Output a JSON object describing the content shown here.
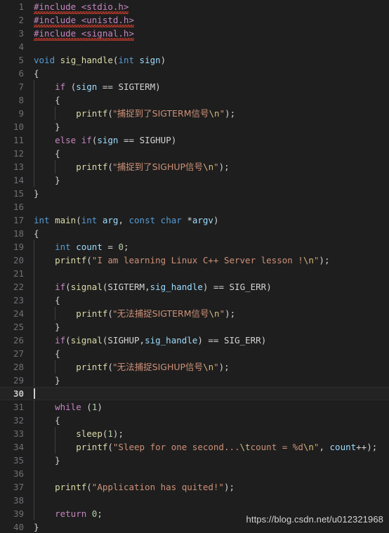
{
  "editor": {
    "theme_name": "dark-plus",
    "background": "#1e1e1e",
    "active_line_background": "#232323",
    "gutter_color": "#6e7074",
    "language": "c",
    "total_lines": 40,
    "active_line": 30,
    "colors": {
      "preprocessor": "#c586c0",
      "keyword": "#c586c0",
      "type": "#569cd6",
      "function": "#dcdcaa",
      "string": "#ce9178",
      "escape": "#d7ba7d",
      "number": "#b5cea8",
      "variable": "#9cdcfe",
      "plain": "#d4d4d4",
      "error_squiggle": "#c0392b",
      "indent_guide": "#3f4042"
    }
  },
  "watermark": {
    "text": "https://blog.csdn.net/u012321968"
  },
  "lines": [
    {
      "n": "1",
      "indent": 0,
      "error": true,
      "tokens": [
        {
          "c": "t-pre",
          "t": "#include <stdio.h>"
        }
      ]
    },
    {
      "n": "2",
      "indent": 0,
      "error": true,
      "tokens": [
        {
          "c": "t-pre",
          "t": "#include <unistd.h>"
        }
      ]
    },
    {
      "n": "3",
      "indent": 0,
      "error": true,
      "tokens": [
        {
          "c": "t-pre",
          "t": "#include <signal.h>"
        }
      ]
    },
    {
      "n": "4",
      "indent": 0,
      "tokens": []
    },
    {
      "n": "5",
      "indent": 0,
      "tokens": [
        {
          "c": "t-type",
          "t": "void"
        },
        {
          "c": "t-plain",
          "t": " "
        },
        {
          "c": "t-fn",
          "t": "sig_handle"
        },
        {
          "c": "t-punct",
          "t": "("
        },
        {
          "c": "t-type",
          "t": "int"
        },
        {
          "c": "t-plain",
          "t": " "
        },
        {
          "c": "t-var",
          "t": "sign"
        },
        {
          "c": "t-punct",
          "t": ")"
        }
      ]
    },
    {
      "n": "6",
      "indent": 0,
      "tokens": [
        {
          "c": "t-brace",
          "t": "{"
        }
      ]
    },
    {
      "n": "7",
      "indent": 1,
      "tokens": [
        {
          "c": "t-plain",
          "t": "    "
        },
        {
          "c": "t-kw",
          "t": "if"
        },
        {
          "c": "t-plain",
          "t": " "
        },
        {
          "c": "t-punct",
          "t": "("
        },
        {
          "c": "t-var",
          "t": "sign"
        },
        {
          "c": "t-plain",
          "t": " "
        },
        {
          "c": "t-op",
          "t": "=="
        },
        {
          "c": "t-plain",
          "t": " "
        },
        {
          "c": "t-const",
          "t": "SIGTERM"
        },
        {
          "c": "t-punct",
          "t": ")"
        }
      ]
    },
    {
      "n": "8",
      "indent": 1,
      "tokens": [
        {
          "c": "t-plain",
          "t": "    "
        },
        {
          "c": "t-brace",
          "t": "{"
        }
      ]
    },
    {
      "n": "9",
      "indent": 2,
      "tokens": [
        {
          "c": "t-plain",
          "t": "        "
        },
        {
          "c": "t-fn",
          "t": "printf"
        },
        {
          "c": "t-punct",
          "t": "("
        },
        {
          "c": "t-str",
          "t": "\"捕捉到了SIGTERM信号"
        },
        {
          "c": "t-esc",
          "t": "\\n"
        },
        {
          "c": "t-str",
          "t": "\""
        },
        {
          "c": "t-punct",
          "t": ");"
        }
      ]
    },
    {
      "n": "10",
      "indent": 1,
      "tokens": [
        {
          "c": "t-plain",
          "t": "    "
        },
        {
          "c": "t-brace",
          "t": "}"
        }
      ]
    },
    {
      "n": "11",
      "indent": 1,
      "tokens": [
        {
          "c": "t-plain",
          "t": "    "
        },
        {
          "c": "t-kw",
          "t": "else"
        },
        {
          "c": "t-plain",
          "t": " "
        },
        {
          "c": "t-kw",
          "t": "if"
        },
        {
          "c": "t-punct",
          "t": "("
        },
        {
          "c": "t-var",
          "t": "sign"
        },
        {
          "c": "t-plain",
          "t": " "
        },
        {
          "c": "t-op",
          "t": "=="
        },
        {
          "c": "t-plain",
          "t": " "
        },
        {
          "c": "t-const",
          "t": "SIGHUP"
        },
        {
          "c": "t-punct",
          "t": ")"
        }
      ]
    },
    {
      "n": "12",
      "indent": 1,
      "tokens": [
        {
          "c": "t-plain",
          "t": "    "
        },
        {
          "c": "t-brace",
          "t": "{"
        }
      ]
    },
    {
      "n": "13",
      "indent": 2,
      "tokens": [
        {
          "c": "t-plain",
          "t": "        "
        },
        {
          "c": "t-fn",
          "t": "printf"
        },
        {
          "c": "t-punct",
          "t": "("
        },
        {
          "c": "t-str",
          "t": "\"捕捉到了SIGHUP信号"
        },
        {
          "c": "t-esc",
          "t": "\\n"
        },
        {
          "c": "t-str",
          "t": "\""
        },
        {
          "c": "t-punct",
          "t": ");"
        }
      ]
    },
    {
      "n": "14",
      "indent": 1,
      "tokens": [
        {
          "c": "t-plain",
          "t": "    "
        },
        {
          "c": "t-brace",
          "t": "}"
        }
      ]
    },
    {
      "n": "15",
      "indent": 0,
      "tokens": [
        {
          "c": "t-brace",
          "t": "}"
        }
      ]
    },
    {
      "n": "16",
      "indent": 0,
      "tokens": []
    },
    {
      "n": "17",
      "indent": 0,
      "tokens": [
        {
          "c": "t-type",
          "t": "int"
        },
        {
          "c": "t-plain",
          "t": " "
        },
        {
          "c": "t-fn",
          "t": "main"
        },
        {
          "c": "t-punct",
          "t": "("
        },
        {
          "c": "t-type",
          "t": "int"
        },
        {
          "c": "t-plain",
          "t": " "
        },
        {
          "c": "t-var",
          "t": "arg"
        },
        {
          "c": "t-punct",
          "t": ", "
        },
        {
          "c": "t-type",
          "t": "const"
        },
        {
          "c": "t-plain",
          "t": " "
        },
        {
          "c": "t-type",
          "t": "char"
        },
        {
          "c": "t-plain",
          "t": " "
        },
        {
          "c": "t-op",
          "t": "*"
        },
        {
          "c": "t-var",
          "t": "argv"
        },
        {
          "c": "t-punct",
          "t": ")"
        }
      ]
    },
    {
      "n": "18",
      "indent": 0,
      "tokens": [
        {
          "c": "t-brace",
          "t": "{"
        }
      ]
    },
    {
      "n": "19",
      "indent": 1,
      "tokens": [
        {
          "c": "t-plain",
          "t": "    "
        },
        {
          "c": "t-type",
          "t": "int"
        },
        {
          "c": "t-plain",
          "t": " "
        },
        {
          "c": "t-var",
          "t": "count"
        },
        {
          "c": "t-plain",
          "t": " "
        },
        {
          "c": "t-op",
          "t": "="
        },
        {
          "c": "t-plain",
          "t": " "
        },
        {
          "c": "t-num",
          "t": "0"
        },
        {
          "c": "t-punct",
          "t": ";"
        }
      ]
    },
    {
      "n": "20",
      "indent": 1,
      "tokens": [
        {
          "c": "t-plain",
          "t": "    "
        },
        {
          "c": "t-fn",
          "t": "printf"
        },
        {
          "c": "t-punct",
          "t": "("
        },
        {
          "c": "t-str",
          "t": "\"I am learning Linux C++ Server lesson !"
        },
        {
          "c": "t-esc",
          "t": "\\n"
        },
        {
          "c": "t-str",
          "t": "\""
        },
        {
          "c": "t-punct",
          "t": ");"
        }
      ]
    },
    {
      "n": "21",
      "indent": 1,
      "tokens": []
    },
    {
      "n": "22",
      "indent": 1,
      "tokens": [
        {
          "c": "t-plain",
          "t": "    "
        },
        {
          "c": "t-kw",
          "t": "if"
        },
        {
          "c": "t-punct",
          "t": "("
        },
        {
          "c": "t-fn",
          "t": "signal"
        },
        {
          "c": "t-punct",
          "t": "("
        },
        {
          "c": "t-const",
          "t": "SIGTERM"
        },
        {
          "c": "t-punct",
          "t": ","
        },
        {
          "c": "t-var",
          "t": "sig_handle"
        },
        {
          "c": "t-punct",
          "t": ")"
        },
        {
          "c": "t-plain",
          "t": " "
        },
        {
          "c": "t-op",
          "t": "=="
        },
        {
          "c": "t-plain",
          "t": " "
        },
        {
          "c": "t-const",
          "t": "SIG_ERR"
        },
        {
          "c": "t-punct",
          "t": ")"
        }
      ]
    },
    {
      "n": "23",
      "indent": 1,
      "tokens": [
        {
          "c": "t-plain",
          "t": "    "
        },
        {
          "c": "t-brace",
          "t": "{"
        }
      ]
    },
    {
      "n": "24",
      "indent": 2,
      "tokens": [
        {
          "c": "t-plain",
          "t": "        "
        },
        {
          "c": "t-fn",
          "t": "printf"
        },
        {
          "c": "t-punct",
          "t": "("
        },
        {
          "c": "t-str",
          "t": "\"无法捕捉SIGTERM信号"
        },
        {
          "c": "t-esc",
          "t": "\\n"
        },
        {
          "c": "t-str",
          "t": "\""
        },
        {
          "c": "t-punct",
          "t": ");"
        }
      ]
    },
    {
      "n": "25",
      "indent": 1,
      "tokens": [
        {
          "c": "t-plain",
          "t": "    "
        },
        {
          "c": "t-brace",
          "t": "}"
        }
      ]
    },
    {
      "n": "26",
      "indent": 1,
      "tokens": [
        {
          "c": "t-plain",
          "t": "    "
        },
        {
          "c": "t-kw",
          "t": "if"
        },
        {
          "c": "t-punct",
          "t": "("
        },
        {
          "c": "t-fn",
          "t": "signal"
        },
        {
          "c": "t-punct",
          "t": "("
        },
        {
          "c": "t-const",
          "t": "SIGHUP"
        },
        {
          "c": "t-punct",
          "t": ","
        },
        {
          "c": "t-var",
          "t": "sig_handle"
        },
        {
          "c": "t-punct",
          "t": ")"
        },
        {
          "c": "t-plain",
          "t": " "
        },
        {
          "c": "t-op",
          "t": "=="
        },
        {
          "c": "t-plain",
          "t": " "
        },
        {
          "c": "t-const",
          "t": "SIG_ERR"
        },
        {
          "c": "t-punct",
          "t": ")"
        }
      ]
    },
    {
      "n": "27",
      "indent": 1,
      "tokens": [
        {
          "c": "t-plain",
          "t": "    "
        },
        {
          "c": "t-brace",
          "t": "{"
        }
      ]
    },
    {
      "n": "28",
      "indent": 2,
      "tokens": [
        {
          "c": "t-plain",
          "t": "        "
        },
        {
          "c": "t-fn",
          "t": "printf"
        },
        {
          "c": "t-punct",
          "t": "("
        },
        {
          "c": "t-str",
          "t": "\"无法捕捉SIGHUP信号"
        },
        {
          "c": "t-esc",
          "t": "\\n"
        },
        {
          "c": "t-str",
          "t": "\""
        },
        {
          "c": "t-punct",
          "t": ");"
        }
      ]
    },
    {
      "n": "29",
      "indent": 1,
      "tokens": [
        {
          "c": "t-plain",
          "t": "    "
        },
        {
          "c": "t-brace",
          "t": "}"
        }
      ]
    },
    {
      "n": "30",
      "indent": 0,
      "active": true,
      "tokens": []
    },
    {
      "n": "31",
      "indent": 1,
      "tokens": [
        {
          "c": "t-plain",
          "t": "    "
        },
        {
          "c": "t-kw",
          "t": "while"
        },
        {
          "c": "t-plain",
          "t": " "
        },
        {
          "c": "t-punct",
          "t": "("
        },
        {
          "c": "t-num",
          "t": "1"
        },
        {
          "c": "t-punct",
          "t": ")"
        }
      ]
    },
    {
      "n": "32",
      "indent": 1,
      "tokens": [
        {
          "c": "t-plain",
          "t": "    "
        },
        {
          "c": "t-brace",
          "t": "{"
        }
      ]
    },
    {
      "n": "33",
      "indent": 2,
      "tokens": [
        {
          "c": "t-plain",
          "t": "        "
        },
        {
          "c": "t-fn",
          "t": "sleep"
        },
        {
          "c": "t-punct",
          "t": "("
        },
        {
          "c": "t-num",
          "t": "1"
        },
        {
          "c": "t-punct",
          "t": ");"
        }
      ]
    },
    {
      "n": "34",
      "indent": 2,
      "tokens": [
        {
          "c": "t-plain",
          "t": "        "
        },
        {
          "c": "t-fn",
          "t": "printf"
        },
        {
          "c": "t-punct",
          "t": "("
        },
        {
          "c": "t-str",
          "t": "\"Sleep for one second..."
        },
        {
          "c": "t-esc",
          "t": "\\t"
        },
        {
          "c": "t-str",
          "t": "count = %d"
        },
        {
          "c": "t-esc",
          "t": "\\n"
        },
        {
          "c": "t-str",
          "t": "\""
        },
        {
          "c": "t-punct",
          "t": ", "
        },
        {
          "c": "t-var",
          "t": "count"
        },
        {
          "c": "t-op",
          "t": "++"
        },
        {
          "c": "t-punct",
          "t": ");"
        }
      ]
    },
    {
      "n": "35",
      "indent": 1,
      "tokens": [
        {
          "c": "t-plain",
          "t": "    "
        },
        {
          "c": "t-brace",
          "t": "}"
        }
      ]
    },
    {
      "n": "36",
      "indent": 1,
      "tokens": []
    },
    {
      "n": "37",
      "indent": 1,
      "tokens": [
        {
          "c": "t-plain",
          "t": "    "
        },
        {
          "c": "t-fn",
          "t": "printf"
        },
        {
          "c": "t-punct",
          "t": "("
        },
        {
          "c": "t-str",
          "t": "\"Application has quited!\""
        },
        {
          "c": "t-punct",
          "t": ");"
        }
      ]
    },
    {
      "n": "38",
      "indent": 1,
      "tokens": []
    },
    {
      "n": "39",
      "indent": 1,
      "tokens": [
        {
          "c": "t-plain",
          "t": "    "
        },
        {
          "c": "t-kw",
          "t": "return"
        },
        {
          "c": "t-plain",
          "t": " "
        },
        {
          "c": "t-num",
          "t": "0"
        },
        {
          "c": "t-punct",
          "t": ";"
        }
      ]
    },
    {
      "n": "40",
      "indent": 0,
      "tokens": [
        {
          "c": "t-brace",
          "t": "}"
        }
      ]
    }
  ]
}
